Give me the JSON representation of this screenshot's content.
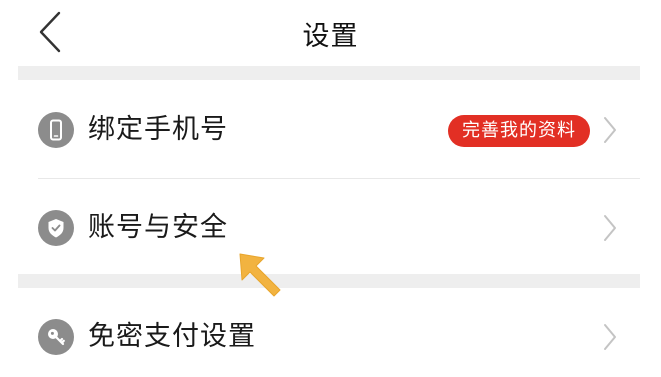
{
  "header": {
    "title": "设置",
    "back_icon": "chevron-left-icon"
  },
  "settings": [
    {
      "id": "bind-phone",
      "label": "绑定手机号",
      "icon": "phone-icon",
      "badge": "完善我的资料"
    },
    {
      "id": "account-security",
      "label": "账号与安全",
      "icon": "shield-check-icon"
    },
    {
      "id": "password-free-pay",
      "label": "免密支付设置",
      "icon": "key-icon"
    }
  ],
  "colors": {
    "badge_bg": "#e22f24",
    "icon_bg": "#8c8c8c",
    "section_gap": "#eeeeee",
    "pointer_arrow": "#f2b340"
  },
  "annotation": {
    "icon": "pointer-arrow-icon"
  }
}
